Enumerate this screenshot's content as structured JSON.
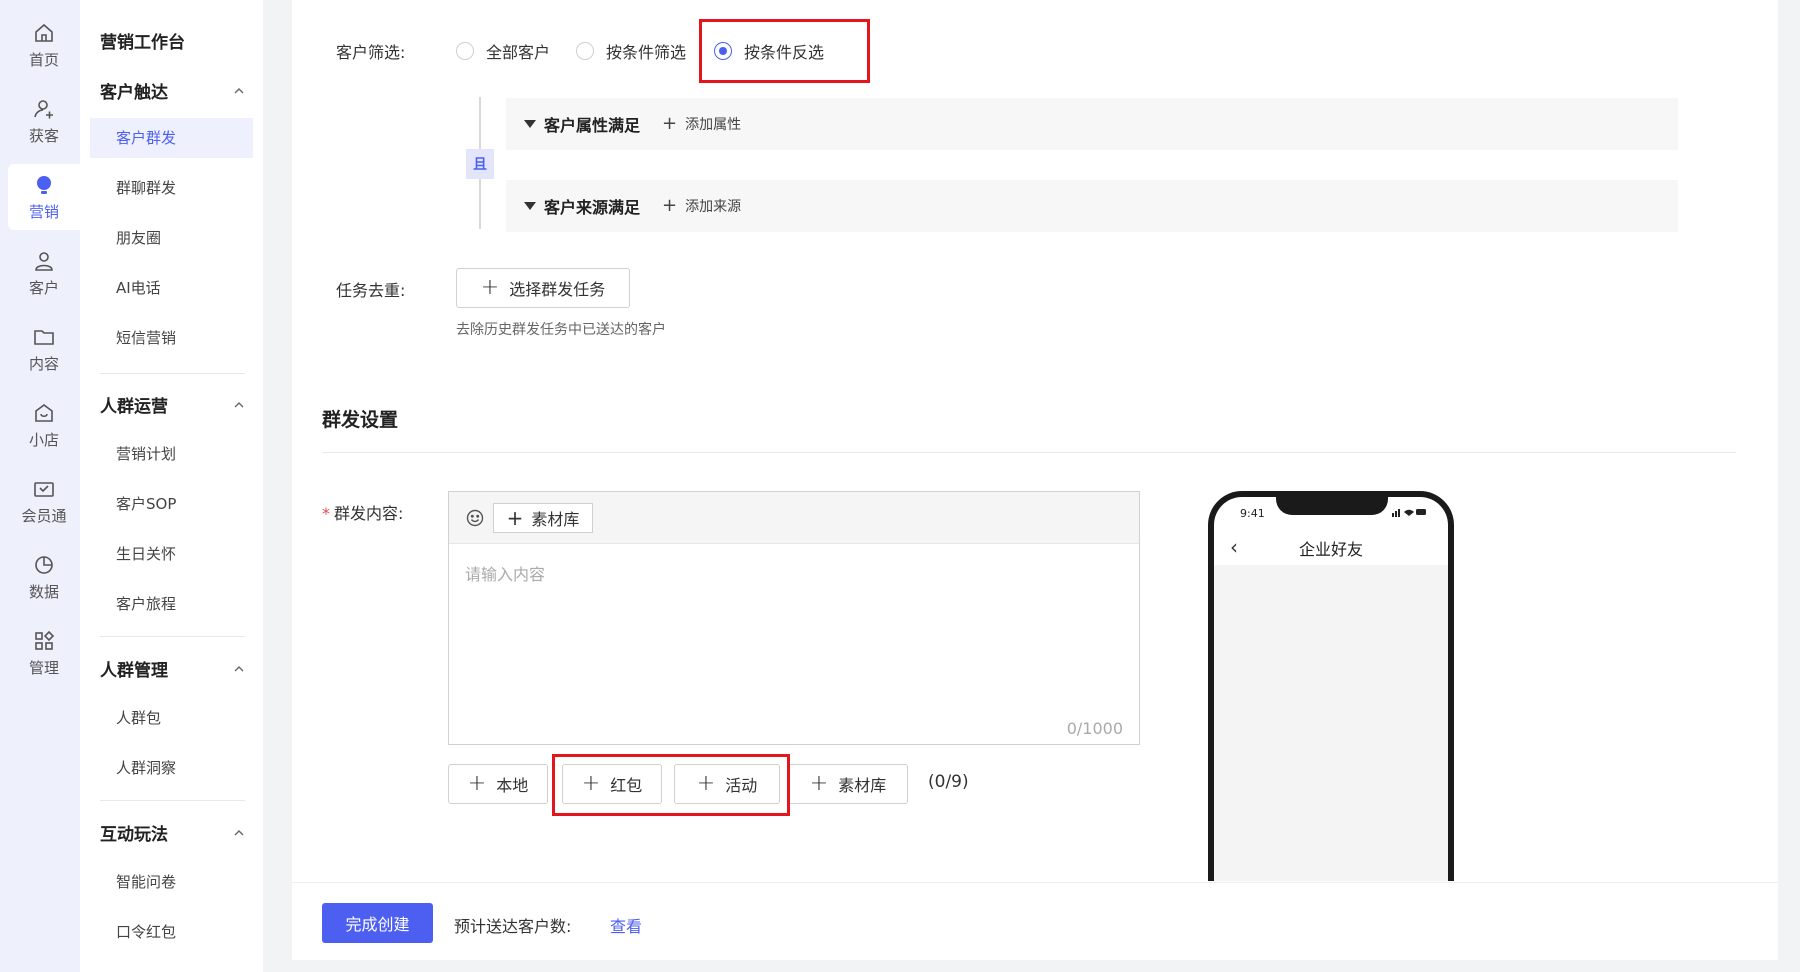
{
  "rail": [
    {
      "label": "首页",
      "icon": "home-icon"
    },
    {
      "label": "获客",
      "icon": "acquire-icon"
    },
    {
      "label": "营销",
      "icon": "marketing-icon",
      "active": true
    },
    {
      "label": "客户",
      "icon": "customer-icon"
    },
    {
      "label": "内容",
      "icon": "folder-icon"
    },
    {
      "label": "小店",
      "icon": "shop-icon"
    },
    {
      "label": "会员通",
      "icon": "member-icon"
    },
    {
      "label": "数据",
      "icon": "chart-icon"
    },
    {
      "label": "管理",
      "icon": "grid-icon"
    }
  ],
  "menu": {
    "title": "营销工作台",
    "groups": [
      {
        "label": "客户触达",
        "items": [
          "客户群发",
          "群聊群发",
          "朋友圈",
          "AI电话",
          "短信营销"
        ]
      },
      {
        "label": "人群运营",
        "items": [
          "营销计划",
          "客户SOP",
          "生日关怀",
          "客户旅程"
        ]
      },
      {
        "label": "人群管理",
        "items": [
          "人群包",
          "人群洞察"
        ]
      },
      {
        "label": "互动玩法",
        "items": [
          "智能问卷",
          "口令红包"
        ]
      }
    ],
    "active_item": "客户群发"
  },
  "filter": {
    "label": "客户筛选:",
    "options": [
      "全部客户",
      "按条件筛选",
      "按条件反选"
    ],
    "selected_index": 2,
    "and_label": "且",
    "conditions": [
      {
        "title": "客户属性满足",
        "add": "添加属性"
      },
      {
        "title": "客户来源满足",
        "add": "添加来源"
      }
    ]
  },
  "dedupe": {
    "label": "任务去重:",
    "button": "选择群发任务",
    "hint": "去除历史群发任务中已送达的客户"
  },
  "section_title": "群发设置",
  "content": {
    "required_mark": "*",
    "label": "群发内容:",
    "toolbar_library": "素材库",
    "placeholder": "请输入内容",
    "counter": "0/1000",
    "attachments": [
      "本地",
      "红包",
      "活动",
      "素材库"
    ],
    "attachment_count": "(0/9)"
  },
  "phone": {
    "time": "9:41",
    "title": "企业好友"
  },
  "footer": {
    "submit": "完成创建",
    "estimate_label": "预计送达客户数:",
    "view_link": "查看"
  },
  "colors": {
    "primary": "#4c5ff0",
    "highlight": "#e3161e"
  }
}
